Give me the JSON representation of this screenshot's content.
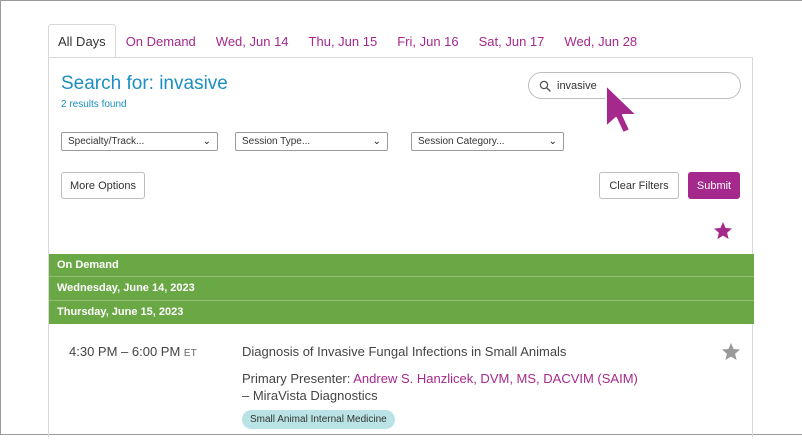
{
  "tabs": [
    {
      "label": "All Days",
      "active": true
    },
    {
      "label": "On Demand",
      "active": false
    },
    {
      "label": "Wed, Jun 14",
      "active": false
    },
    {
      "label": "Thu, Jun 15",
      "active": false
    },
    {
      "label": "Fri, Jun 16",
      "active": false
    },
    {
      "label": "Sat, Jun 17",
      "active": false
    },
    {
      "label": "Wed, Jun 28",
      "active": false
    }
  ],
  "search": {
    "heading": "Search for: invasive",
    "results_text": "2 results found",
    "input_value": "invasive",
    "icon": "search-icon"
  },
  "filters": {
    "specialty": "Specialty/Track...",
    "session_type": "Session Type...",
    "session_category": "Session Category..."
  },
  "buttons": {
    "more_options": "More Options",
    "clear_filters": "Clear Filters",
    "submit": "Submit"
  },
  "day_groups": [
    "On Demand",
    "Wednesday, June 14, 2023",
    "Thursday, June 15, 2023"
  ],
  "session": {
    "time": "4:30 PM – 6:00 PM",
    "timezone": "ET",
    "title": "Diagnosis of Invasive Fungal Infections in Small Animals",
    "presenter_prefix": "Primary Presenter: ",
    "presenter_name": "Andrew S. Hanzlicek, DVM, MS, DACVIM (SAIM)",
    "presenter_suffix": " – MiraVista Diagnostics",
    "tag": "Small Animal Internal Medicine"
  },
  "colors": {
    "accent": "#a5288c",
    "heading_blue": "#1c8fc0",
    "day_bar_green": "#6aa846",
    "tag_bg": "#b9e3e5",
    "star_inactive": "#9a9a9a"
  }
}
